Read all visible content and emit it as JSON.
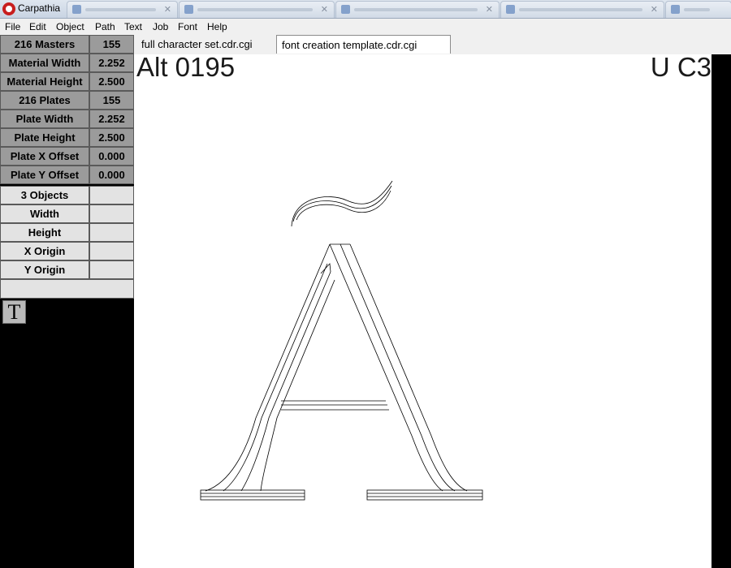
{
  "window": {
    "title": "Carpathia"
  },
  "menu": [
    "File",
    "Edit",
    "Object",
    "Path",
    "Text",
    "Job",
    "Font",
    "Help"
  ],
  "panel": {
    "rows": [
      {
        "label": "216 Masters",
        "value": "155",
        "style": "dark"
      },
      {
        "label": "Material Width",
        "value": "2.252",
        "style": "dark"
      },
      {
        "label": "Material Height",
        "value": "2.500",
        "style": "dark"
      },
      {
        "label": "216 Plates",
        "value": "155",
        "style": "dark"
      },
      {
        "label": "Plate Width",
        "value": "2.252",
        "style": "dark"
      },
      {
        "label": "Plate Height",
        "value": "2.500",
        "style": "dark"
      },
      {
        "label": "Plate X Offset",
        "value": "0.000",
        "style": "dark"
      },
      {
        "label": "Plate Y Offset",
        "value": "0.000",
        "style": "dark"
      },
      {
        "label": "3 Objects",
        "value": "",
        "style": "light"
      },
      {
        "label": "Width",
        "value": "",
        "style": "light"
      },
      {
        "label": "Height",
        "value": "",
        "style": "light"
      },
      {
        "label": "X Origin",
        "value": "",
        "style": "light"
      },
      {
        "label": "Y Origin",
        "value": "",
        "style": "light"
      }
    ],
    "text_tool_icon": "T"
  },
  "tabs": [
    {
      "label": "full character set.cdr.cgi",
      "active": false
    },
    {
      "label": "font creation template.cdr.cgi",
      "active": true
    }
  ],
  "canvas": {
    "alt_code": "Alt 0195",
    "unicode": "U C3"
  },
  "colors": {
    "panel_dark": "#9b9b9b",
    "panel_light": "#e3e3e3",
    "canvas": "#ffffff",
    "logo": "#c81e1e"
  }
}
